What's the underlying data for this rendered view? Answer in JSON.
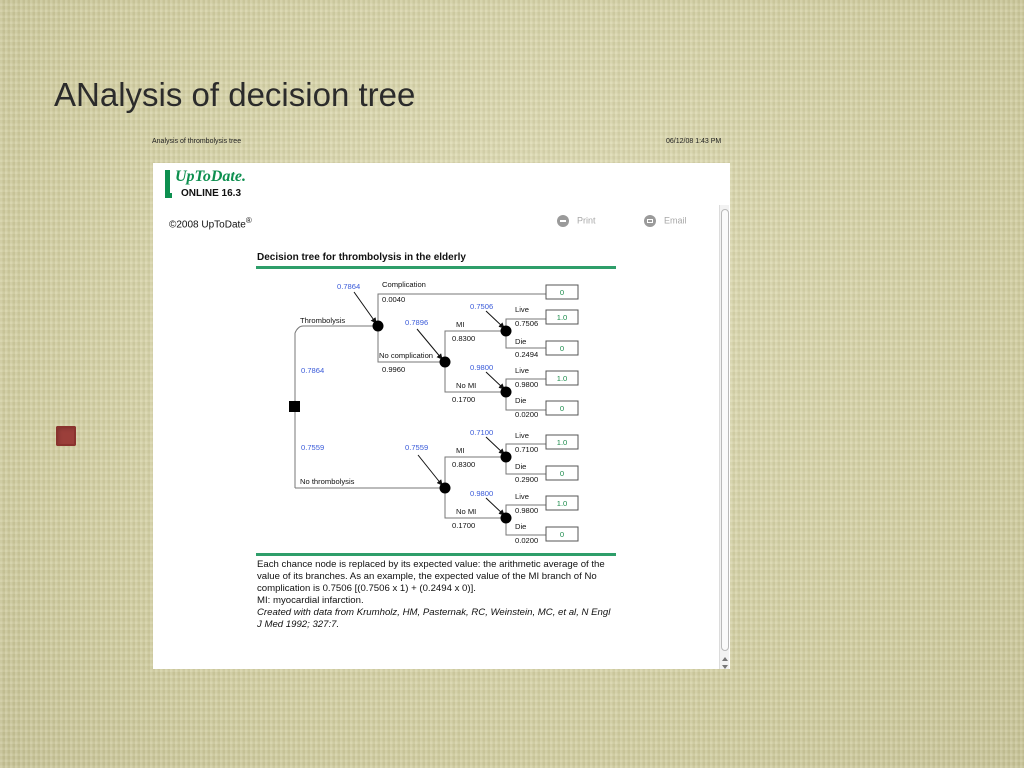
{
  "slide": {
    "title": "ANalysis of decision tree"
  },
  "print_header": {
    "left": "Analysis of thrombolysis tree",
    "right": "06/12/08 1:43 PM"
  },
  "logo": {
    "name": "UpToDate.",
    "version": "ONLINE 16.3"
  },
  "copyright": {
    "text": "©2008 UpToDate",
    "mark": "®"
  },
  "toolbar": {
    "print_label": "Print",
    "email_label": "Email"
  },
  "colors": {
    "brand_green": "#0d8f4f",
    "probability_blue": "#3a5bd9",
    "outcome_green": "#1a8a4a",
    "rule_green": "#2e9e6a"
  },
  "tree": {
    "title": "Decision tree for thrombolysis in the elderly",
    "texts": {
      "ev_complication": "0.7864",
      "complication": "Complication",
      "p_complication": "0.0040",
      "out_complication": "0",
      "thrombolysis": "Thrombolysis",
      "ev_thrombolysis": "0.7864",
      "ev_no_complication": "0.7896",
      "no_complication": "No complication",
      "p_no_complication": "0.9960",
      "a_ev_mi": "0.7506",
      "a_mi": "MI",
      "a_p_mi": "0.8300",
      "a_live": "Live",
      "a_p_live": "0.7506",
      "a_out_live": "1.0",
      "a_die": "Die",
      "a_p_die": "0.2494",
      "a_out_die": "0",
      "a_ev_nomi": "0.9800",
      "a_nomi": "No MI",
      "a_p_nomi": "0.1700",
      "a_live2": "Live",
      "a_p_live2": "0.9800",
      "a_out_live2": "1.0",
      "a_die2": "Die",
      "a_p_die2": "0.0200",
      "a_out_die2": "0",
      "ev_no_thrombolysis": "0.7559",
      "no_thrombolysis": "No thrombolysis",
      "ev_nt_node": "0.7559",
      "b_ev_mi": "0.7100",
      "b_mi": "MI",
      "b_p_mi": "0.8300",
      "b_live": "Live",
      "b_p_live": "0.7100",
      "b_out_live": "1.0",
      "b_die": "Die",
      "b_p_die": "0.2900",
      "b_out_die": "0",
      "b_ev_nomi": "0.9800",
      "b_nomi": "No MI",
      "b_p_nomi": "0.1700",
      "b_live2": "Live",
      "b_p_live2": "0.9800",
      "b_out_live2": "1.0",
      "b_die2": "Die",
      "b_p_die2": "0.0200",
      "b_out_die2": "0"
    }
  },
  "caption": {
    "line1": "Each chance node is replaced by its expected value: the arithmetic average of the value of its branches. As an example, the expected value of the MI branch of No complication is 0.7506 [(0.7506 x 1) + (0.2494 x 0)].",
    "line2": "MI: myocardial infarction.",
    "line3": "Created with data from Krumholz, HM, Pasternak, RC, Weinstein, MC, et al, N Engl J Med 1992; 327:7."
  }
}
